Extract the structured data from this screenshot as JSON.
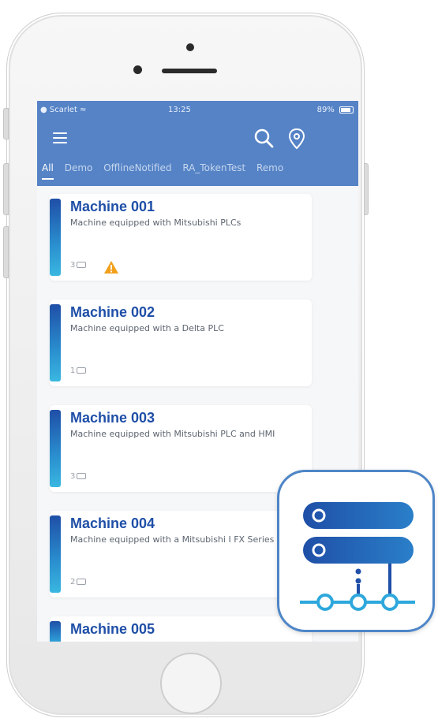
{
  "status_bar": {
    "carrier": "Scarlet",
    "time": "13:25",
    "battery": "89%"
  },
  "tabs": [
    {
      "label": "All",
      "active": true
    },
    {
      "label": "Demo",
      "active": false
    },
    {
      "label": "OfflineNotified",
      "active": false
    },
    {
      "label": "RA_TokenTest",
      "active": false
    },
    {
      "label": "Remo",
      "active": false
    }
  ],
  "machines": [
    {
      "name": "Machine 001",
      "description": "Machine equipped with Mitsubishi PLCs",
      "count": "3",
      "warning": true
    },
    {
      "name": "Machine 002",
      "description": "Machine equipped with a Delta PLC",
      "count": "1",
      "warning": false
    },
    {
      "name": "Machine 003",
      "description": "Machine equipped with Mitsubishi PLC and HMI",
      "count": "3",
      "warning": false
    },
    {
      "name": "Machine 004",
      "description": "Machine equipped with a Mitsubishi I FX Series",
      "count": "2",
      "warning": false
    },
    {
      "name": "Machine 005"
    }
  ],
  "icons": {
    "menu": "hamburger-menu-icon",
    "search": "search-icon",
    "location": "location-pin-icon",
    "warning": "warning-triangle-icon",
    "app": "server-network-app-icon"
  },
  "colors": {
    "appbar": "#5583c6",
    "accent": "#1f4fa7",
    "stripe_light": "#3ab7e0",
    "warning": "#f2a01c",
    "icon_border": "#4e86c7"
  }
}
